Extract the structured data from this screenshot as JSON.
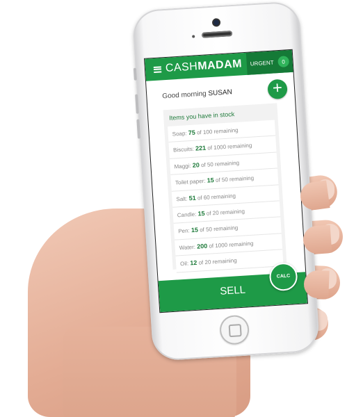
{
  "app": {
    "brand_light": "CASH",
    "brand_bold": "MADAM",
    "menu_icon": "hamburger-menu-icon"
  },
  "header": {
    "urgent_label": "URGENT",
    "urgent_count": "0"
  },
  "greeting": {
    "prefix": "Good morning",
    "name": "SUSAN"
  },
  "add_button": {
    "label": "+"
  },
  "stock": {
    "title": "Items you have in stock",
    "items": [
      {
        "name": "Soap:",
        "count": "75",
        "suffix": "of 100 remaining"
      },
      {
        "name": "Biscuits:",
        "count": "221",
        "suffix": "of 1000 remaining"
      },
      {
        "name": "Maggi:",
        "count": "20",
        "suffix": "of 50 remaining"
      },
      {
        "name": "Toilet paper:",
        "count": "15",
        "suffix": "of 50 remaining"
      },
      {
        "name": "Salt:",
        "count": "51",
        "suffix": "of 60 remaining"
      },
      {
        "name": "Candle:",
        "count": "15",
        "suffix": "of 20 remaining"
      },
      {
        "name": "Pen:",
        "count": "15",
        "suffix": "of 50 remaining"
      },
      {
        "name": "Water:",
        "count": "200",
        "suffix": "of 1000 remaining"
      },
      {
        "name": "Oil:",
        "count": "12",
        "suffix": "of 20 remaining"
      }
    ]
  },
  "footer": {
    "sell_label": "SELL",
    "calc_label": "CALC"
  },
  "colors": {
    "primary_green": "#1e9a47",
    "dark_green": "#157a37",
    "count_green": "#1e7a3a"
  }
}
